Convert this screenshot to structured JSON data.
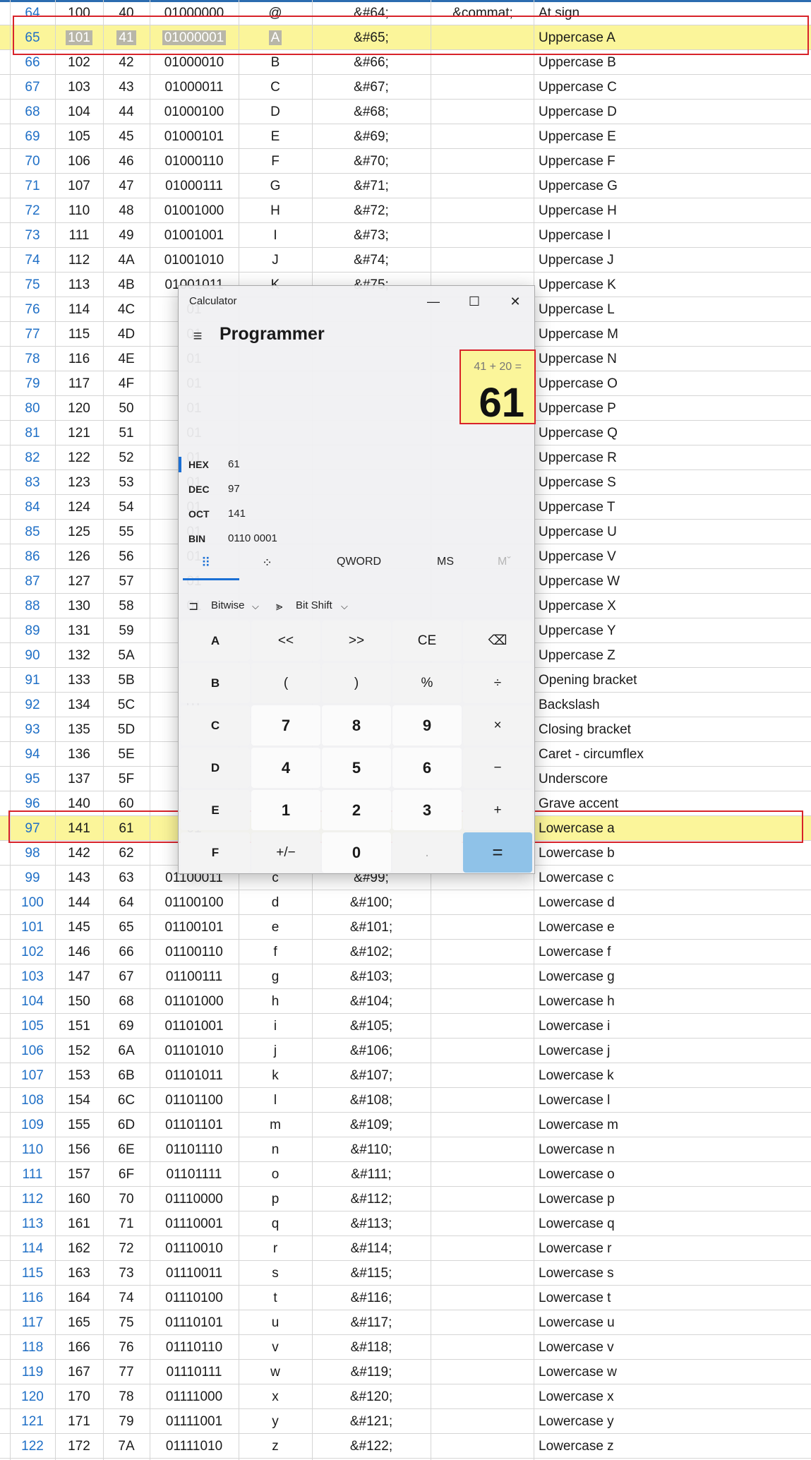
{
  "table": {
    "rows": [
      {
        "dec": "64",
        "oct": "100",
        "hex": "40",
        "bin": "01000000",
        "symbol": "@",
        "entity": "&#64;",
        "name": "&commat;",
        "desc": "At sign"
      },
      {
        "dec": "65",
        "oct": "101",
        "hex": "41",
        "bin": "01000001",
        "symbol": "A",
        "entity": "&#65;",
        "name": "",
        "desc": "Uppercase A"
      },
      {
        "dec": "66",
        "oct": "102",
        "hex": "42",
        "bin": "01000010",
        "symbol": "B",
        "entity": "&#66;",
        "name": "",
        "desc": "Uppercase B"
      },
      {
        "dec": "67",
        "oct": "103",
        "hex": "43",
        "bin": "01000011",
        "symbol": "C",
        "entity": "&#67;",
        "name": "",
        "desc": "Uppercase C"
      },
      {
        "dec": "68",
        "oct": "104",
        "hex": "44",
        "bin": "01000100",
        "symbol": "D",
        "entity": "&#68;",
        "name": "",
        "desc": "Uppercase D"
      },
      {
        "dec": "69",
        "oct": "105",
        "hex": "45",
        "bin": "01000101",
        "symbol": "E",
        "entity": "&#69;",
        "name": "",
        "desc": "Uppercase E"
      },
      {
        "dec": "70",
        "oct": "106",
        "hex": "46",
        "bin": "01000110",
        "symbol": "F",
        "entity": "&#70;",
        "name": "",
        "desc": "Uppercase F"
      },
      {
        "dec": "71",
        "oct": "107",
        "hex": "47",
        "bin": "01000111",
        "symbol": "G",
        "entity": "&#71;",
        "name": "",
        "desc": "Uppercase G"
      },
      {
        "dec": "72",
        "oct": "110",
        "hex": "48",
        "bin": "01001000",
        "symbol": "H",
        "entity": "&#72;",
        "name": "",
        "desc": "Uppercase H"
      },
      {
        "dec": "73",
        "oct": "111",
        "hex": "49",
        "bin": "01001001",
        "symbol": "I",
        "entity": "&#73;",
        "name": "",
        "desc": "Uppercase I"
      },
      {
        "dec": "74",
        "oct": "112",
        "hex": "4A",
        "bin": "01001010",
        "symbol": "J",
        "entity": "&#74;",
        "name": "",
        "desc": "Uppercase J"
      },
      {
        "dec": "75",
        "oct": "113",
        "hex": "4B",
        "bin": "01001011",
        "symbol": "K",
        "entity": "&#75;",
        "name": "",
        "desc": "Uppercase K"
      },
      {
        "dec": "76",
        "oct": "114",
        "hex": "4C",
        "bin": "01",
        "symbol": "",
        "entity": "",
        "name": "",
        "desc": "Uppercase L"
      },
      {
        "dec": "77",
        "oct": "115",
        "hex": "4D",
        "bin": "01",
        "symbol": "",
        "entity": "",
        "name": "",
        "desc": "Uppercase M"
      },
      {
        "dec": "78",
        "oct": "116",
        "hex": "4E",
        "bin": "01",
        "symbol": "",
        "entity": "",
        "name": "",
        "desc": "Uppercase N"
      },
      {
        "dec": "79",
        "oct": "117",
        "hex": "4F",
        "bin": "01",
        "symbol": "",
        "entity": "",
        "name": "",
        "desc": "Uppercase O"
      },
      {
        "dec": "80",
        "oct": "120",
        "hex": "50",
        "bin": "01",
        "symbol": "",
        "entity": "",
        "name": "",
        "desc": "Uppercase P"
      },
      {
        "dec": "81",
        "oct": "121",
        "hex": "51",
        "bin": "01",
        "symbol": "",
        "entity": "",
        "name": "",
        "desc": "Uppercase Q"
      },
      {
        "dec": "82",
        "oct": "122",
        "hex": "52",
        "bin": "01",
        "symbol": "",
        "entity": "",
        "name": "",
        "desc": "Uppercase R"
      },
      {
        "dec": "83",
        "oct": "123",
        "hex": "53",
        "bin": "01",
        "symbol": "",
        "entity": "",
        "name": "",
        "desc": "Uppercase S"
      },
      {
        "dec": "84",
        "oct": "124",
        "hex": "54",
        "bin": "01",
        "symbol": "",
        "entity": "",
        "name": "",
        "desc": "Uppercase T"
      },
      {
        "dec": "85",
        "oct": "125",
        "hex": "55",
        "bin": "01",
        "symbol": "",
        "entity": "",
        "name": "",
        "desc": "Uppercase U"
      },
      {
        "dec": "86",
        "oct": "126",
        "hex": "56",
        "bin": "01",
        "symbol": "",
        "entity": "",
        "name": "",
        "desc": "Uppercase V"
      },
      {
        "dec": "87",
        "oct": "127",
        "hex": "57",
        "bin": "01",
        "symbol": "",
        "entity": "",
        "name": "",
        "desc": "Uppercase W"
      },
      {
        "dec": "88",
        "oct": "130",
        "hex": "58",
        "bin": "01",
        "symbol": "",
        "entity": "",
        "name": "",
        "desc": "Uppercase X"
      },
      {
        "dec": "89",
        "oct": "131",
        "hex": "59",
        "bin": "01",
        "symbol": "",
        "entity": "",
        "name": "",
        "desc": "Uppercase Y"
      },
      {
        "dec": "90",
        "oct": "132",
        "hex": "5A",
        "bin": "01",
        "symbol": "",
        "entity": "",
        "name": "",
        "desc": "Uppercase Z"
      },
      {
        "dec": "91",
        "oct": "133",
        "hex": "5B",
        "bin": "01",
        "symbol": "",
        "entity": "",
        "name": "",
        "desc": "Opening bracket"
      },
      {
        "dec": "92",
        "oct": "134",
        "hex": "5C",
        "bin": "01",
        "symbol": "",
        "entity": "",
        "name": "",
        "desc": "Backslash"
      },
      {
        "dec": "93",
        "oct": "135",
        "hex": "5D",
        "bin": "01",
        "symbol": "",
        "entity": "",
        "name": "",
        "desc": "Closing bracket"
      },
      {
        "dec": "94",
        "oct": "136",
        "hex": "5E",
        "bin": "01",
        "symbol": "",
        "entity": "",
        "name": "",
        "desc": "Caret - circumflex"
      },
      {
        "dec": "95",
        "oct": "137",
        "hex": "5F",
        "bin": "01",
        "symbol": "",
        "entity": "",
        "name": "",
        "desc": "Underscore"
      },
      {
        "dec": "96",
        "oct": "140",
        "hex": "60",
        "bin": "01",
        "symbol": "",
        "entity": "",
        "name": "",
        "desc": "Grave accent"
      },
      {
        "dec": "97",
        "oct": "141",
        "hex": "61",
        "bin": "01",
        "symbol": "",
        "entity": "",
        "name": "",
        "desc": "Lowercase a"
      },
      {
        "dec": "98",
        "oct": "142",
        "hex": "62",
        "bin": "01",
        "symbol": "",
        "entity": "",
        "name": "",
        "desc": "Lowercase b"
      },
      {
        "dec": "99",
        "oct": "143",
        "hex": "63",
        "bin": "01100011",
        "symbol": "c",
        "entity": "&#99;",
        "name": "",
        "desc": "Lowercase c"
      },
      {
        "dec": "100",
        "oct": "144",
        "hex": "64",
        "bin": "01100100",
        "symbol": "d",
        "entity": "&#100;",
        "name": "",
        "desc": "Lowercase d"
      },
      {
        "dec": "101",
        "oct": "145",
        "hex": "65",
        "bin": "01100101",
        "symbol": "e",
        "entity": "&#101;",
        "name": "",
        "desc": "Lowercase e"
      },
      {
        "dec": "102",
        "oct": "146",
        "hex": "66",
        "bin": "01100110",
        "symbol": "f",
        "entity": "&#102;",
        "name": "",
        "desc": "Lowercase f"
      },
      {
        "dec": "103",
        "oct": "147",
        "hex": "67",
        "bin": "01100111",
        "symbol": "g",
        "entity": "&#103;",
        "name": "",
        "desc": "Lowercase g"
      },
      {
        "dec": "104",
        "oct": "150",
        "hex": "68",
        "bin": "01101000",
        "symbol": "h",
        "entity": "&#104;",
        "name": "",
        "desc": "Lowercase h"
      },
      {
        "dec": "105",
        "oct": "151",
        "hex": "69",
        "bin": "01101001",
        "symbol": "i",
        "entity": "&#105;",
        "name": "",
        "desc": "Lowercase i"
      },
      {
        "dec": "106",
        "oct": "152",
        "hex": "6A",
        "bin": "01101010",
        "symbol": "j",
        "entity": "&#106;",
        "name": "",
        "desc": "Lowercase j"
      },
      {
        "dec": "107",
        "oct": "153",
        "hex": "6B",
        "bin": "01101011",
        "symbol": "k",
        "entity": "&#107;",
        "name": "",
        "desc": "Lowercase k"
      },
      {
        "dec": "108",
        "oct": "154",
        "hex": "6C",
        "bin": "01101100",
        "symbol": "l",
        "entity": "&#108;",
        "name": "",
        "desc": "Lowercase l"
      },
      {
        "dec": "109",
        "oct": "155",
        "hex": "6D",
        "bin": "01101101",
        "symbol": "m",
        "entity": "&#109;",
        "name": "",
        "desc": "Lowercase m"
      },
      {
        "dec": "110",
        "oct": "156",
        "hex": "6E",
        "bin": "01101110",
        "symbol": "n",
        "entity": "&#110;",
        "name": "",
        "desc": "Lowercase n"
      },
      {
        "dec": "111",
        "oct": "157",
        "hex": "6F",
        "bin": "01101111",
        "symbol": "o",
        "entity": "&#111;",
        "name": "",
        "desc": "Lowercase o"
      },
      {
        "dec": "112",
        "oct": "160",
        "hex": "70",
        "bin": "01110000",
        "symbol": "p",
        "entity": "&#112;",
        "name": "",
        "desc": "Lowercase p"
      },
      {
        "dec": "113",
        "oct": "161",
        "hex": "71",
        "bin": "01110001",
        "symbol": "q",
        "entity": "&#113;",
        "name": "",
        "desc": "Lowercase q"
      },
      {
        "dec": "114",
        "oct": "162",
        "hex": "72",
        "bin": "01110010",
        "symbol": "r",
        "entity": "&#114;",
        "name": "",
        "desc": "Lowercase r"
      },
      {
        "dec": "115",
        "oct": "163",
        "hex": "73",
        "bin": "01110011",
        "symbol": "s",
        "entity": "&#115;",
        "name": "",
        "desc": "Lowercase s"
      },
      {
        "dec": "116",
        "oct": "164",
        "hex": "74",
        "bin": "01110100",
        "symbol": "t",
        "entity": "&#116;",
        "name": "",
        "desc": "Lowercase t"
      },
      {
        "dec": "117",
        "oct": "165",
        "hex": "75",
        "bin": "01110101",
        "symbol": "u",
        "entity": "&#117;",
        "name": "",
        "desc": "Lowercase u"
      },
      {
        "dec": "118",
        "oct": "166",
        "hex": "76",
        "bin": "01110110",
        "symbol": "v",
        "entity": "&#118;",
        "name": "",
        "desc": "Lowercase v"
      },
      {
        "dec": "119",
        "oct": "167",
        "hex": "77",
        "bin": "01110111",
        "symbol": "w",
        "entity": "&#119;",
        "name": "",
        "desc": "Lowercase w"
      },
      {
        "dec": "120",
        "oct": "170",
        "hex": "78",
        "bin": "01111000",
        "symbol": "x",
        "entity": "&#120;",
        "name": "",
        "desc": "Lowercase x"
      },
      {
        "dec": "121",
        "oct": "171",
        "hex": "79",
        "bin": "01111001",
        "symbol": "y",
        "entity": "&#121;",
        "name": "",
        "desc": "Lowercase y"
      },
      {
        "dec": "122",
        "oct": "172",
        "hex": "7A",
        "bin": "01111010",
        "symbol": "z",
        "entity": "&#122;",
        "name": "",
        "desc": "Lowercase z"
      }
    ],
    "highlighted_rows": [
      "65",
      "97"
    ],
    "highlight_color": "#fbf59a",
    "outline_color": "#d8232a",
    "link_color": "#1f6fc6"
  },
  "calculator": {
    "window_title": "Calculator",
    "window_buttons": {
      "minimize": "—",
      "maximize": "☐",
      "close": "✕"
    },
    "menu_icon": "≡",
    "mode": "Programmer",
    "expression": "41 + 20 =",
    "result": "61",
    "radix": [
      {
        "name": "HEX",
        "value": "61",
        "active": true
      },
      {
        "name": "DEC",
        "value": "97",
        "active": false
      },
      {
        "name": "OCT",
        "value": "141",
        "active": false
      },
      {
        "name": "BIN",
        "value": "0110 0001",
        "active": false
      }
    ],
    "tabs": {
      "keypad_icon": "⠿",
      "bit_toggle_icon": "⁘",
      "word_size": "QWORD",
      "memory_store": "MS",
      "memory_recall": "Mˇ"
    },
    "operations": {
      "bitwise_icon": "⊐",
      "bitwise": "Bitwise",
      "bitshift_icon": "⪢",
      "bitshift": "Bit Shift",
      "chevron": "⌵"
    },
    "keys": [
      [
        "A",
        "<<",
        ">>",
        "CE",
        "⌫"
      ],
      [
        "B",
        "(",
        ")",
        "%",
        "÷"
      ],
      [
        "C",
        "7",
        "8",
        "9",
        "×"
      ],
      [
        "D",
        "4",
        "5",
        "6",
        "−"
      ],
      [
        "E",
        "1",
        "2",
        "3",
        "+"
      ],
      [
        "F",
        "+/−",
        "0",
        ".",
        "="
      ]
    ],
    "accent_color": "#1a6fd4",
    "equals_color": "#8fc2e8"
  }
}
